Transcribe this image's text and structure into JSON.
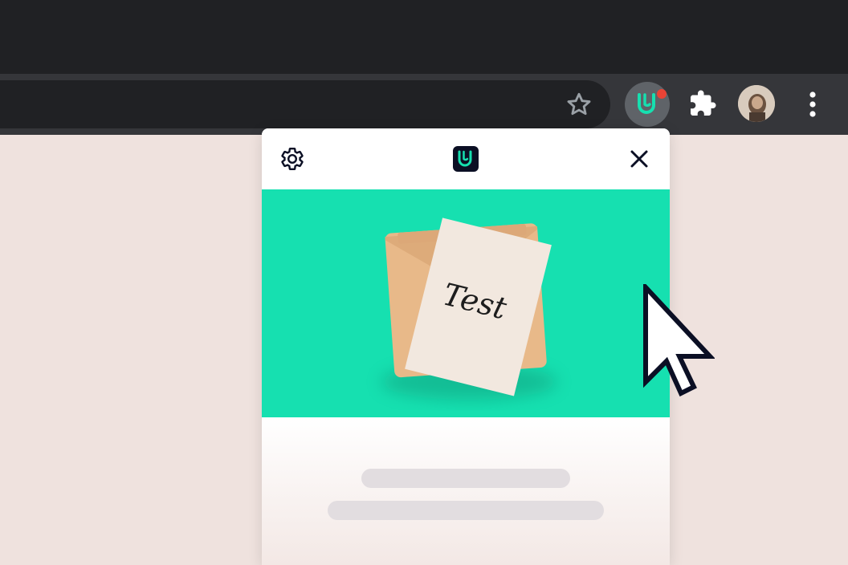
{
  "browser": {
    "icons": {
      "bookmark": "star-outline",
      "extension": "u-logo",
      "extensions_menu": "puzzle-piece",
      "profile": "avatar",
      "menu": "vertical-ellipsis"
    },
    "colors": {
      "tabstrip": "#202124",
      "toolbar": "#35363a",
      "notification_dot": "#ea4335"
    }
  },
  "popup": {
    "header": {
      "icons": {
        "settings": "gear",
        "brand": "u-logo",
        "close": "x"
      }
    },
    "hero": {
      "note_text": "Test",
      "background": "#16e0b0"
    },
    "skeleton_lines": 2
  },
  "colors": {
    "accent": "#16e0b0",
    "brand_dark": "#0b0f24",
    "page_background": "#efe2de"
  }
}
